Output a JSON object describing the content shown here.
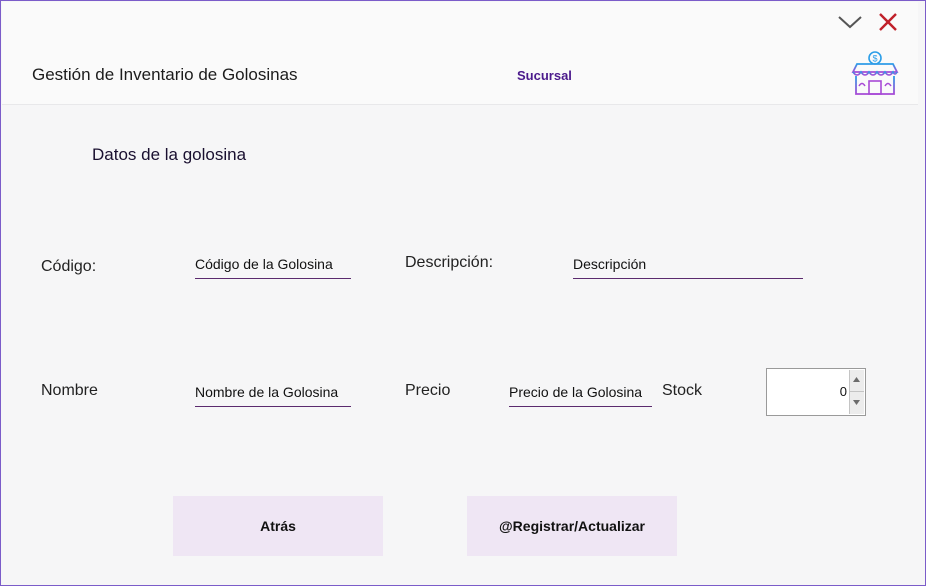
{
  "header": {
    "title": "Gestión de Inventario de Golosinas",
    "branch": "Sucursal",
    "minimize_icon": "chevron-down-icon",
    "close_icon": "close-icon",
    "store_icon": "store-icon"
  },
  "section": {
    "title": "Datos de la golosina"
  },
  "form": {
    "codigo_label": "Código:",
    "codigo_placeholder": "Código de la Golosina",
    "descripcion_label": "Descripción:",
    "descripcion_placeholder": "Descripción",
    "nombre_label": "Nombre",
    "nombre_placeholder": "Nombre de la Golosina",
    "precio_label": "Precio",
    "precio_placeholder": "Precio de la Golosina",
    "stock_label": "Stock",
    "stock_value": "0"
  },
  "actions": {
    "back_label": "Atrás",
    "save_label": "@Registrar/Actualizar"
  },
  "colors": {
    "accent": "#4b1a8c",
    "close": "#c0202a",
    "button_bg": "#efe6f4",
    "underline": "#5b2a6e"
  }
}
